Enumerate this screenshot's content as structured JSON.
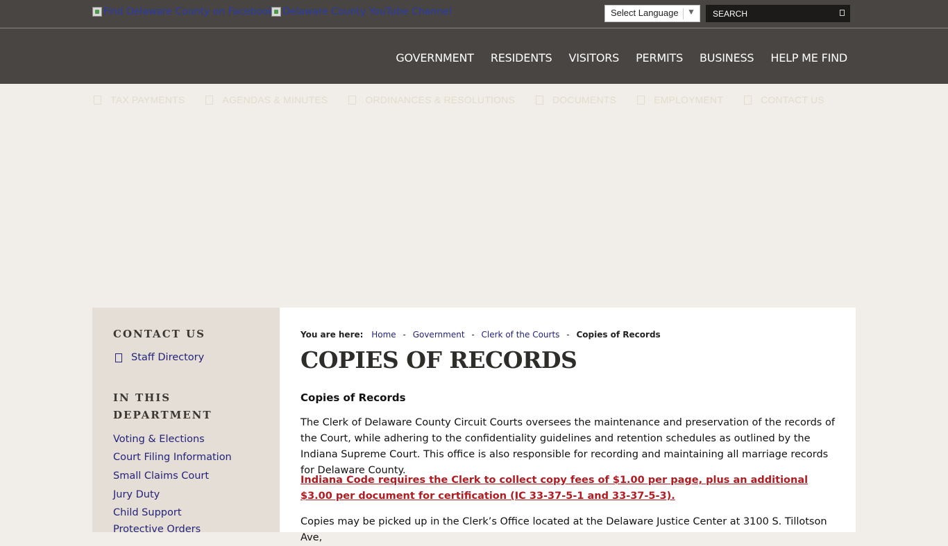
{
  "header": {
    "facebook_alt": "Find Delaware County on Facebook",
    "youtube_alt": "Delaware County YouTube Channel",
    "language_label": "Select Language",
    "search_placeholder": "SEARCH"
  },
  "nav": {
    "items": [
      "GOVERNMENT",
      "RESIDENTS",
      "VISITORS",
      "PERMITS",
      "BUSINESS",
      "HELP ME FIND"
    ]
  },
  "quick_links": [
    "TAX PAYMENTS",
    "AGENDAS & MINUTES",
    "ORDINANCES & RESOLUTIONS",
    "DOCUMENTS",
    "EMPLOYMENT",
    "CONTACT US"
  ],
  "sidebar": {
    "contact_heading": "CONTACT US",
    "staff_directory": "Staff Directory",
    "dept_heading_line1": "IN THIS",
    "dept_heading_line2": "DEPARTMENT",
    "dept_links": [
      "Voting & Elections",
      "Court Filing Information",
      "Small Claims Court",
      "Jury Duty",
      "Child Support",
      "Protective Orders"
    ]
  },
  "breadcrumb": {
    "prefix": "You are here:",
    "links": [
      "Home",
      "Government",
      "Clerk of the Courts"
    ],
    "current": "Copies of Records"
  },
  "content": {
    "title": "COPIES OF RECORDS",
    "subtitle": "Copies of Records",
    "para1": "The Clerk of Delaware County Circuit Courts oversees the maintenance and preservation of the records of the Court, while adhering to the confidentiality guidelines and retention schedules as outlined by the Indiana Supreme Court. This office is also responsible for recording and maintaining all marriage records for Delaware County.",
    "fee_notice": "Indiana Code requires the Clerk to collect copy fees of $1.00 per page, plus an additional $3.00 per document for certification (IC 33-37-5-1 and 33-37-5-3).",
    "para2": "Copies may be picked up in the Clerk’s Office located at the Delaware Justice Center at 3100 S. Tillotson Ave,"
  },
  "colors": {
    "header_bg": "#484542",
    "page_bg": "#f1eee9",
    "sidebar_bg": "#e5ded6",
    "link": "#24237a",
    "alert": "#b01c22"
  }
}
